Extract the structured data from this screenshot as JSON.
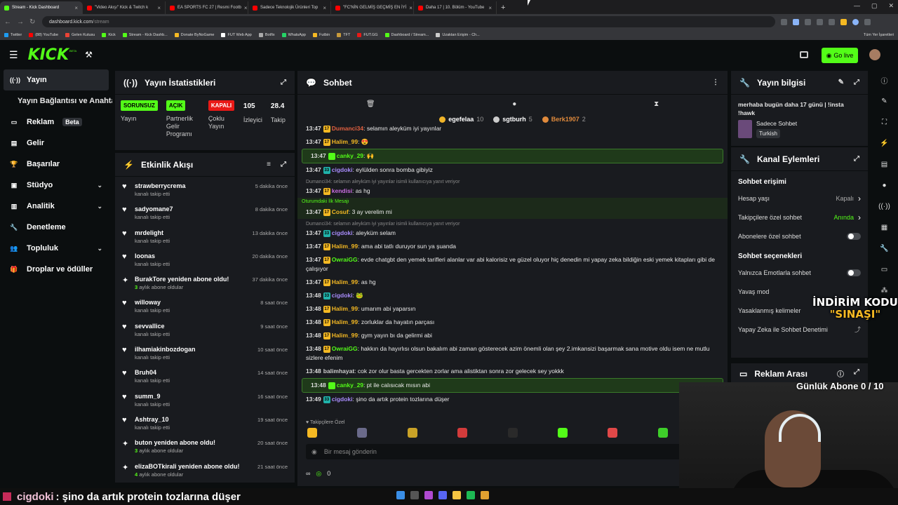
{
  "browser": {
    "tabs": [
      {
        "title": "Stream - Kick Dashboard",
        "color": "#53fc18",
        "active": true
      },
      {
        "title": "\"Video Akışı\" Kick & Twitch k",
        "color": "#ff0000",
        "active": false
      },
      {
        "title": "EA SPORTS FC 27 | Resmi Footb",
        "color": "#ff0000",
        "active": false
      },
      {
        "title": "Sadece Teknolojik Ürünleri Top",
        "color": "#ff0000",
        "active": false
      },
      {
        "title": "\"FC'NİN GELMİŞ GEÇMİŞ EN İYİ",
        "color": "#ff0000",
        "active": false
      },
      {
        "title": "Daha 17 | 10. Bölüm - YouTube",
        "color": "#ff0000",
        "active": false
      }
    ],
    "url_host": "dashboard.kick.com",
    "url_path": "/stream",
    "bookmarks": [
      {
        "label": "Twitter",
        "color": "#1d9bf0"
      },
      {
        "label": "(88) YouTube",
        "color": "#ff0000"
      },
      {
        "label": "Gelen Kutusu",
        "color": "#ea4335"
      },
      {
        "label": "Kick",
        "color": "#53fc18"
      },
      {
        "label": "Stream - Kick Dashb...",
        "color": "#53fc18"
      },
      {
        "label": "Donate ByNoGame",
        "color": "#f5b923"
      },
      {
        "label": "FUT Web App",
        "color": "#ffffff"
      },
      {
        "label": "Botfix",
        "color": "#aaaaaa"
      },
      {
        "label": "WhatsApp",
        "color": "#25d366"
      },
      {
        "label": "Futbin",
        "color": "#f5b923"
      },
      {
        "label": "TFT",
        "color": "#c89b3c"
      },
      {
        "label": "FUT.GG",
        "color": "#e91916"
      },
      {
        "label": "Dashboard / Stream...",
        "color": "#53fc18"
      },
      {
        "label": "Uzaktan Erişim - Ch...",
        "color": "#cccccc"
      }
    ],
    "all_bookmarks": "Tüm Yer İşaretleri"
  },
  "header": {
    "logo": "KICK",
    "logo_badge": "BETA",
    "go_live": "Go live"
  },
  "sidebar": {
    "items": [
      {
        "label": "Yayın",
        "icon": "broadcast-icon",
        "active": true
      },
      {
        "label": "Yayın Bağlantısı ve Anahtarı",
        "sub": true
      },
      {
        "label": "Reklam",
        "icon": "tv-icon",
        "badge": "Beta"
      },
      {
        "label": "Gelir",
        "icon": "money-icon"
      },
      {
        "label": "Başarılar",
        "icon": "trophy-icon"
      },
      {
        "label": "Stüdyo",
        "icon": "studio-icon",
        "chevron": true
      },
      {
        "label": "Analitik",
        "icon": "chart-icon",
        "chevron": true
      },
      {
        "label": "Denetleme",
        "icon": "wrench-icon"
      },
      {
        "label": "Topluluk",
        "icon": "users-icon",
        "chevron": true
      },
      {
        "label": "Droplar ve ödüller",
        "icon": "gift-icon"
      }
    ]
  },
  "stats": {
    "title": "Yayın İstatistikleri",
    "cols": [
      {
        "pill": "SORUNSUZ",
        "pill_color": "green",
        "label": "Yayın"
      },
      {
        "pill": "AÇIK",
        "pill_color": "green",
        "label": "Partnerlik Gelir Programı"
      },
      {
        "pill": "KAPALI",
        "pill_color": "red",
        "label": "Çoklu Yayın"
      },
      {
        "num": "105",
        "label": "İzleyici"
      },
      {
        "num": "28.4",
        "label": "Takip"
      }
    ]
  },
  "activity": {
    "title": "Etkinlik Akışı",
    "items": [
      {
        "name": "strawberrycrema",
        "sub": "kanalı takip etti",
        "time": "5 dakika önce",
        "type": "follow"
      },
      {
        "name": "sadyomane7",
        "sub": "kanalı takip etti",
        "time": "8 dakika önce",
        "type": "follow"
      },
      {
        "name": "mrdelight",
        "sub": "kanalı takip etti",
        "time": "13 dakika önce",
        "type": "follow"
      },
      {
        "name": "loonas",
        "sub": "kanalı takip etti",
        "time": "20 dakika önce",
        "type": "follow"
      },
      {
        "name": "BurakTore yeniden abone oldu!",
        "sub_bold": "3",
        "sub": "aylık abone oldular",
        "time": "37 dakika önce",
        "type": "sub"
      },
      {
        "name": "willoway",
        "sub": "kanalı takip etti",
        "time": "8 saat önce",
        "type": "follow"
      },
      {
        "name": "sevvallice",
        "sub": "kanalı takip etti",
        "time": "9 saat önce",
        "type": "follow"
      },
      {
        "name": "ilhamiakinbozdogan",
        "sub": "kanalı takip etti",
        "time": "10 saat önce",
        "type": "follow"
      },
      {
        "name": "Bruh04",
        "sub": "kanalı takip etti",
        "time": "14 saat önce",
        "type": "follow"
      },
      {
        "name": "summ_9",
        "sub": "kanalı takip etti",
        "time": "16 saat önce",
        "type": "follow"
      },
      {
        "name": "Ashtray_10",
        "sub": "kanalı takip etti",
        "time": "19 saat önce",
        "type": "follow"
      },
      {
        "name": "buton yeniden abone oldu!",
        "sub_bold": "3",
        "sub": "aylık abone oldular",
        "time": "20 saat önce",
        "type": "sub"
      },
      {
        "name": "elizaBOTkirali yeniden abone oldu!",
        "sub_bold": "4",
        "sub": "aylık abone oldular",
        "time": "21 saat önce",
        "type": "sub"
      }
    ]
  },
  "chat": {
    "title": "Sohbet",
    "pinned": [
      {
        "name": "egefelaa",
        "count": "10",
        "color": "#f0b429"
      },
      {
        "name": "sgtburh",
        "count": "5",
        "color": "#cccccc"
      },
      {
        "name": "Berk1907",
        "count": "2",
        "color": "#e08a3c"
      }
    ],
    "messages": [
      {
        "time": "13:47",
        "user": "Dumanci34",
        "color": "#e06040",
        "badge": "17",
        "text": "selamın aleyküm iyi yayınlar"
      },
      {
        "time": "13:47",
        "user": "Halim_99",
        "color": "#f5b923",
        "badge": "17",
        "text": "😍"
      },
      {
        "time": "13:47",
        "user": "canky_29",
        "color": "#53fc18",
        "badge": "mod",
        "text": "🙌",
        "highlight": true
      },
      {
        "time": "13:47",
        "user": "cigdoki",
        "color": "#a78bfa",
        "badge": "33",
        "text": "eylülden sonra bomba gibiyiz"
      },
      {
        "reply": "Dumanci34: selamın aleyküm iyi yayınlar isimli kullanıcıya yanıt veriyor",
        "time": "13:47",
        "user": "kendisi",
        "color": "#c86de0",
        "badge": "17",
        "text": "as hg"
      },
      {
        "first_label": "Oturumdaki İlk Mesajı",
        "time": "13:47",
        "user": "Cosuf",
        "color": "#f5b923",
        "badge": "17",
        "text": "3 ay verelim mi"
      },
      {
        "reply": "Dumanci34: selamın aleyküm iyi yayınlar isimli kullanıcıya yanıt veriyor",
        "time": "13:47",
        "user": "cigdoki",
        "color": "#a78bfa",
        "badge": "33",
        "text": "aleyküm selam"
      },
      {
        "time": "13:47",
        "user": "Halim_99",
        "color": "#f5b923",
        "badge": "17",
        "text": "ama abi tatlı duruyor sun ya şuanda"
      },
      {
        "time": "13:47",
        "user": "OwraiGG",
        "color": "#53fc18",
        "badge": "17",
        "text": "evde chatgbt den yemek tarifleri alanlar var abi kalorisiz ve güzel oluyor hiç denedin mi yapay zeka bildiğin eski yemek kitapları gibi de çalışıyor"
      },
      {
        "time": "13:47",
        "user": "Halim_99",
        "color": "#f5b923",
        "badge": "17",
        "text": "as hg"
      },
      {
        "time": "13:48",
        "user": "cigdoki",
        "color": "#a78bfa",
        "badge": "33",
        "text": "🐸"
      },
      {
        "time": "13:48",
        "user": "Halim_99",
        "color": "#f5b923",
        "badge": "17",
        "text": "umarım abi yaparsın"
      },
      {
        "time": "13:48",
        "user": "Halim_99",
        "color": "#f5b923",
        "badge": "17",
        "text": "zorluklar da hayatın parçası"
      },
      {
        "time": "13:48",
        "user": "Halim_99",
        "color": "#f5b923",
        "badge": "17",
        "text": "gym yayın bı da gelirmi abi"
      },
      {
        "time": "13:48",
        "user": "OwraiGG",
        "color": "#53fc18",
        "badge": "17",
        "text": "hakkın da hayırlısı olsun bakalım abi zaman gösterecek azim önemli olan şey 2.imkansizi başarmak sana motive oldu isem ne mutlu sizlere efenim"
      },
      {
        "time": "13:48",
        "user": "balimhayat",
        "color": "#cccccc",
        "badge": "",
        "text": "cok zor olur basta gercekten zorlar ama alistiktan sonra zor gelecek sey yokkk"
      },
      {
        "time": "13:48",
        "user": "canky_29",
        "color": "#53fc18",
        "badge": "mod",
        "text": "pt ile calısıcak mısın abi",
        "highlight": true
      },
      {
        "time": "13:49",
        "user": "cigdoki",
        "color": "#a78bfa",
        "badge": "33",
        "text": "şino da artık protein tozlarına düşer"
      }
    ],
    "emote_label": "Takipçilere Özel",
    "input_placeholder": "Bir mesaj gönderin",
    "points": "0"
  },
  "info": {
    "title": "Yayın bilgisi",
    "stream_title": "merhaba bugün daha 17 günü | !insta !hawk",
    "category": "Sadece Sohbet",
    "language": "Turkish"
  },
  "actions": {
    "title": "Kanal Eylemleri",
    "access_title": "Sohbet erişimi",
    "rows1": [
      {
        "label": "Hesap yaşı",
        "value": "Kapalı",
        "green": false,
        "control": "chevron"
      },
      {
        "label": "Takipçilere özel sohbet",
        "value": "Anında",
        "green": true,
        "control": "chevron"
      },
      {
        "label": "Abonelere özel sohbet",
        "value": "",
        "control": "toggle"
      }
    ],
    "options_title": "Sohbet seçenekleri",
    "rows2": [
      {
        "label": "Yalnızca Emotlarla sohbet",
        "value": "",
        "control": "toggle"
      },
      {
        "label": "Yavaş mod",
        "value": "",
        "control": "none"
      },
      {
        "label": "Yasaklanmış kelimeler",
        "value": "",
        "control": "none"
      },
      {
        "label": "Yapay Zeka ile Sohbet Denetimi",
        "value": "",
        "control": "external"
      }
    ]
  },
  "ads": {
    "title": "Reklam Arası"
  },
  "overlay": {
    "promo_line1": "İNDİRİM KODU",
    "promo_line2": "\"SINAŞI\"",
    "daily_sub": "Günlük Abone 0 / 10",
    "subtitle_user": "cigdoki",
    "subtitle_text": ": şino da artık protein tozlarına düşer"
  }
}
